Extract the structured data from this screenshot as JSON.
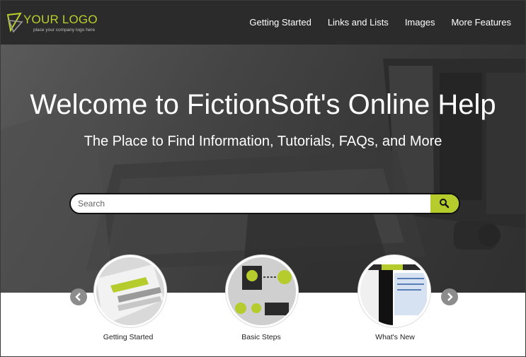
{
  "logo": {
    "text": "YOUR LOGO",
    "tagline": "place your company logo here"
  },
  "nav": [
    "Getting Started",
    "Links and Lists",
    "Images",
    "More Features"
  ],
  "hero": {
    "title": "Welcome to FictionSoft's Online Help",
    "subtitle": "The Place to Find Information, Tutorials, FAQs, and More"
  },
  "search": {
    "placeholder": "Search"
  },
  "carousel": {
    "items": [
      {
        "label": "Getting Started"
      },
      {
        "label": "Basic Steps"
      },
      {
        "label": "What's New"
      }
    ]
  },
  "colors": {
    "accent": "#b6cc2c",
    "header_bg": "#2b2b2b",
    "arrow": "#8c8c8c"
  }
}
